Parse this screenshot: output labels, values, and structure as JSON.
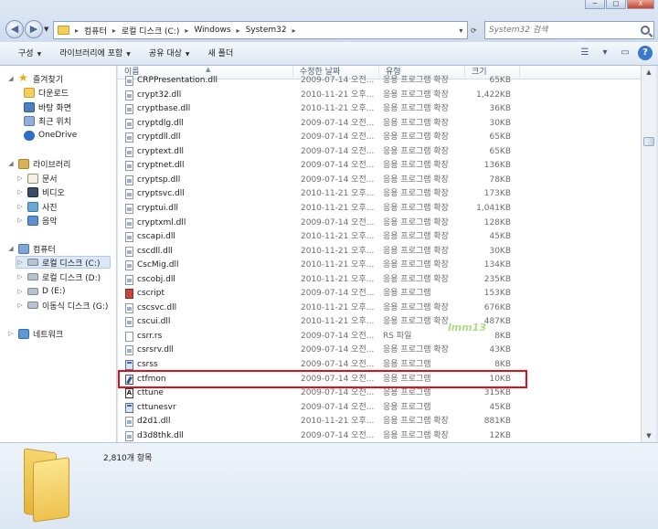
{
  "titlebar": {
    "minimize": "─",
    "maximize": "□",
    "close": "X"
  },
  "address": {
    "crumbs": [
      "컴퓨터",
      "로컬 디스크 (C:)",
      "Windows",
      "System32"
    ],
    "separator": "▸",
    "search_placeholder": "System32 검색"
  },
  "toolbar": {
    "organize": "구성",
    "include_library": "라이브러리에 포함",
    "share_with": "공유 대상",
    "new_folder": "새 폴더"
  },
  "nav": {
    "favorites": "즐겨찾기",
    "downloads": "다운로드",
    "desktop": "바탕 화면",
    "recent": "최근 위치",
    "onedrive": "OneDrive",
    "libraries": "라이브러리",
    "documents": "문서",
    "videos": "비디오",
    "pictures": "사진",
    "music": "음악",
    "computer": "컴퓨터",
    "drive_c": "로컬 디스크 (C:)",
    "drive_d": "로컬 디스크 (D:)",
    "drive_e": "D (E:)",
    "drive_g": "이동식 디스크 (G:)",
    "network": "네트워크"
  },
  "columns": {
    "name": "이름",
    "date": "수정한 날짜",
    "type": "유형",
    "size": "크기"
  },
  "files": [
    {
      "name": "CRPPresentation.dll",
      "date": "2009-07-14 오전...",
      "type": "응용 프로그램 확장",
      "size": "65KB",
      "icon": "dll"
    },
    {
      "name": "crypt32.dll",
      "date": "2010-11-21 오후...",
      "type": "응용 프로그램 확장",
      "size": "1,422KB",
      "icon": "dll"
    },
    {
      "name": "cryptbase.dll",
      "date": "2010-11-21 오후...",
      "type": "응용 프로그램 확장",
      "size": "36KB",
      "icon": "dll"
    },
    {
      "name": "cryptdlg.dll",
      "date": "2009-07-14 오전...",
      "type": "응용 프로그램 확장",
      "size": "30KB",
      "icon": "dll"
    },
    {
      "name": "cryptdll.dll",
      "date": "2009-07-14 오전...",
      "type": "응용 프로그램 확장",
      "size": "65KB",
      "icon": "dll"
    },
    {
      "name": "cryptext.dll",
      "date": "2009-07-14 오전...",
      "type": "응용 프로그램 확장",
      "size": "65KB",
      "icon": "dll"
    },
    {
      "name": "cryptnet.dll",
      "date": "2009-07-14 오전...",
      "type": "응용 프로그램 확장",
      "size": "136KB",
      "icon": "dll"
    },
    {
      "name": "cryptsp.dll",
      "date": "2009-07-14 오전...",
      "type": "응용 프로그램 확장",
      "size": "78KB",
      "icon": "dll"
    },
    {
      "name": "cryptsvc.dll",
      "date": "2010-11-21 오후...",
      "type": "응용 프로그램 확장",
      "size": "173KB",
      "icon": "dll"
    },
    {
      "name": "cryptui.dll",
      "date": "2010-11-21 오후...",
      "type": "응용 프로그램 확장",
      "size": "1,041KB",
      "icon": "dll"
    },
    {
      "name": "cryptxml.dll",
      "date": "2009-07-14 오전...",
      "type": "응용 프로그램 확장",
      "size": "128KB",
      "icon": "dll"
    },
    {
      "name": "cscapi.dll",
      "date": "2010-11-21 오후...",
      "type": "응용 프로그램 확장",
      "size": "45KB",
      "icon": "dll"
    },
    {
      "name": "cscdll.dll",
      "date": "2010-11-21 오후...",
      "type": "응용 프로그램 확장",
      "size": "30KB",
      "icon": "dll"
    },
    {
      "name": "CscMig.dll",
      "date": "2010-11-21 오후...",
      "type": "응용 프로그램 확장",
      "size": "134KB",
      "icon": "dll"
    },
    {
      "name": "cscobj.dll",
      "date": "2010-11-21 오후...",
      "type": "응용 프로그램 확장",
      "size": "235KB",
      "icon": "dll"
    },
    {
      "name": "cscript",
      "date": "2009-07-14 오전...",
      "type": "응용 프로그램",
      "size": "153KB",
      "icon": "cscript"
    },
    {
      "name": "cscsvc.dll",
      "date": "2010-11-21 오후...",
      "type": "응용 프로그램 확장",
      "size": "676KB",
      "icon": "dll"
    },
    {
      "name": "cscui.dll",
      "date": "2010-11-21 오후...",
      "type": "응용 프로그램 확장",
      "size": "487KB",
      "icon": "dll"
    },
    {
      "name": "csrr.rs",
      "date": "2009-07-14 오전...",
      "type": "RS 파일",
      "size": "8KB",
      "icon": "rs"
    },
    {
      "name": "csrsrv.dll",
      "date": "2009-07-14 오전...",
      "type": "응용 프로그램 확장",
      "size": "43KB",
      "icon": "dll"
    },
    {
      "name": "csrss",
      "date": "2009-07-14 오전...",
      "type": "응용 프로그램",
      "size": "8KB",
      "icon": "exe"
    },
    {
      "name": "ctfmon",
      "date": "2009-07-14 오전...",
      "type": "응용 프로그램",
      "size": "10KB",
      "icon": "ctfmon"
    },
    {
      "name": "cttune",
      "date": "2009-07-14 오전...",
      "type": "응용 프로그램",
      "size": "315KB",
      "icon": "cttune"
    },
    {
      "name": "cttunesvr",
      "date": "2009-07-14 오전...",
      "type": "응용 프로그램",
      "size": "45KB",
      "icon": "exe"
    },
    {
      "name": "d2d1.dll",
      "date": "2010-11-21 오후...",
      "type": "응용 프로그램 확장",
      "size": "881KB",
      "icon": "dll"
    },
    {
      "name": "d3d8thk.dll",
      "date": "2009-07-14 오전...",
      "type": "응용 프로그램 확장",
      "size": "12KB",
      "icon": "dll"
    }
  ],
  "details": {
    "item_count": "2,810개 항목"
  },
  "watermark": "lmm13"
}
